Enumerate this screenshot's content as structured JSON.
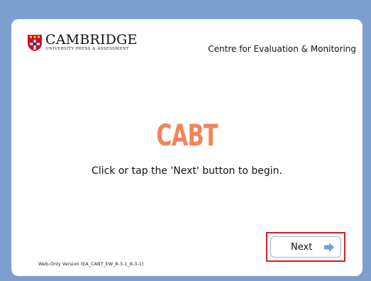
{
  "header": {
    "brand_main": "CAMBRIDGE",
    "brand_sub": "UNIVERSITY PRESS & ASSESSMENT",
    "centre_title": "Centre for Evaluation & Monitoring"
  },
  "main": {
    "title": "CABT",
    "instruction": "Click or tap the 'Next' button to begin."
  },
  "footer": {
    "next_label": "Next",
    "version": "Web-Only Version (EA_CABT_EW_8-3-1_8-3-1)"
  },
  "colors": {
    "page_background": "#7d9fcd",
    "title": "#f0855c",
    "highlight_border": "#cf1f26",
    "next_arrow": "#6f9fe0",
    "shield_red": "#c8102e"
  },
  "icons": {
    "logo": "cambridge-shield-icon",
    "next": "right-arrow-icon"
  }
}
